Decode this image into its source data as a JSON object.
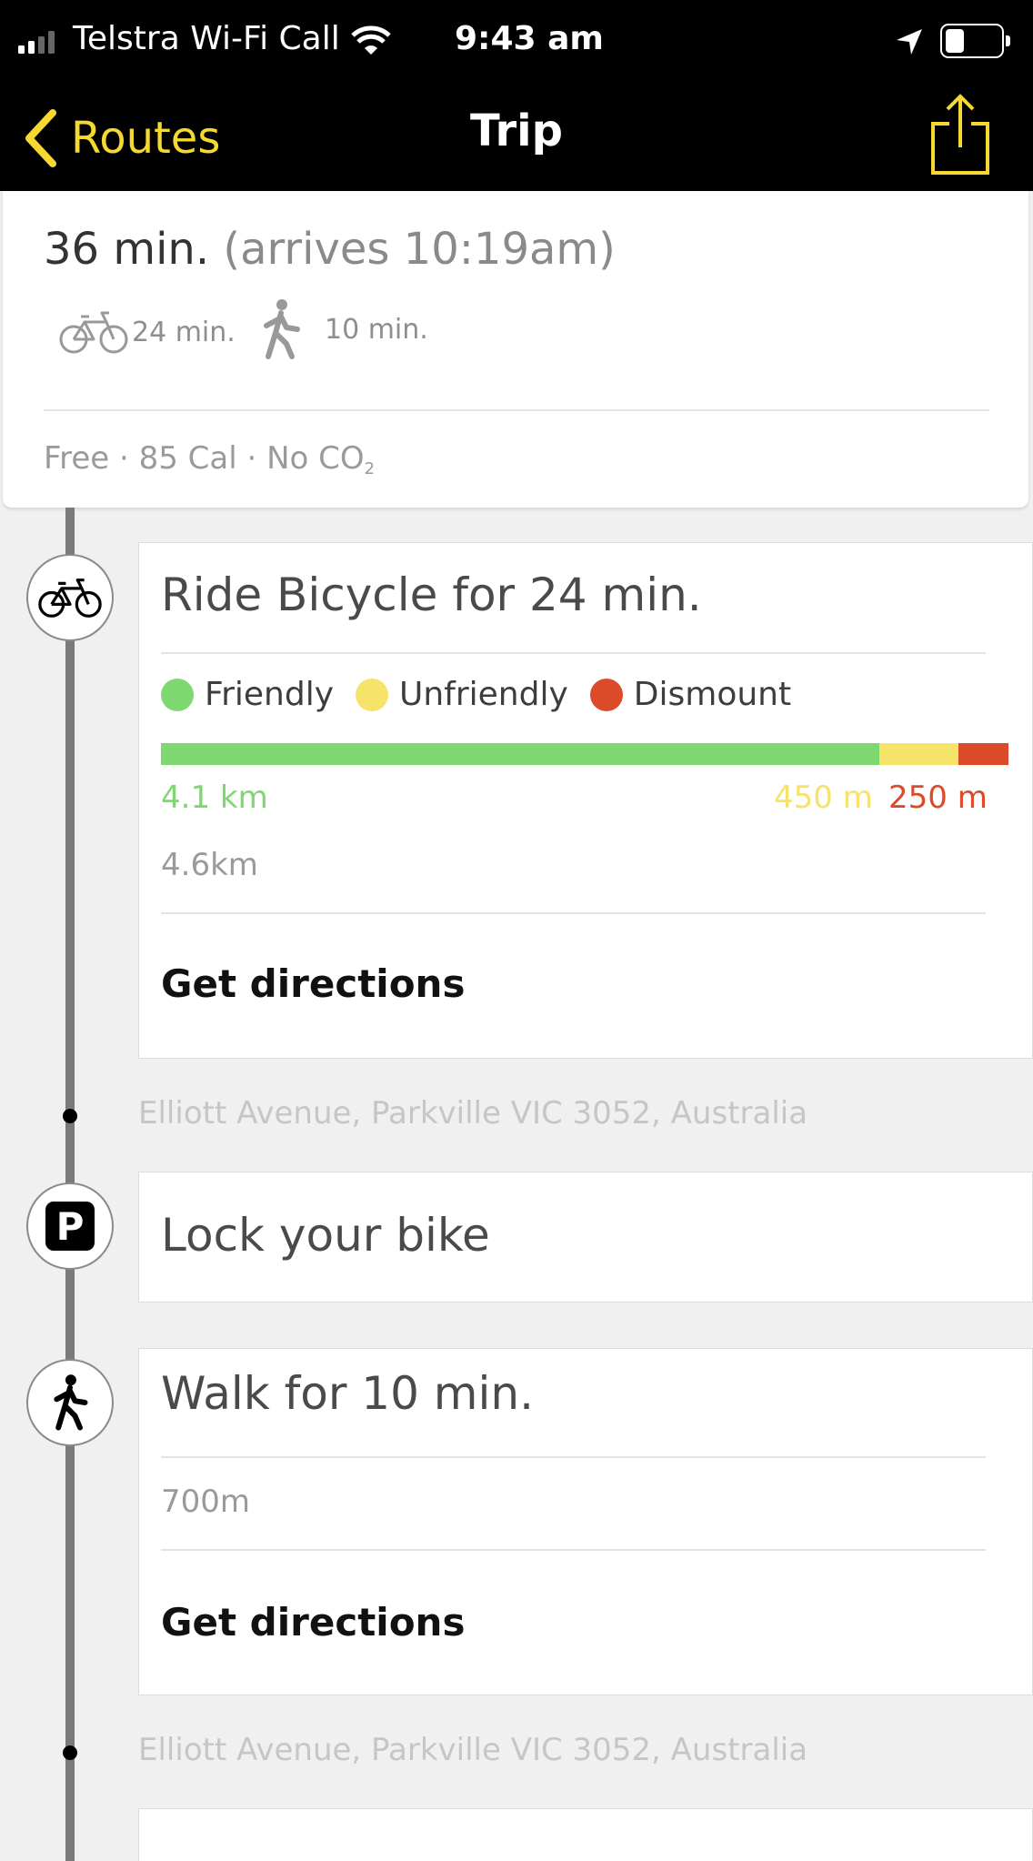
{
  "status_bar": {
    "carrier": "Telstra Wi-Fi Call",
    "time": "9:43 am",
    "signal_bars": 2,
    "battery_level": 0.35
  },
  "nav": {
    "back_label": "Routes",
    "title": "Trip",
    "back_icon": "chevron-left-icon",
    "share_icon": "share-icon"
  },
  "summary": {
    "duration": "36 min.",
    "arrives": "(arrives 10:19am)",
    "modes": [
      {
        "icon": "bicycle-icon",
        "time": "24 min."
      },
      {
        "icon": "walk-icon",
        "time": "10 min."
      }
    ],
    "meta": "Free · 85 Cal · No CO",
    "meta_sub": "2"
  },
  "steps": {
    "ride": {
      "icon": "bicycle-icon",
      "title": "Ride Bicycle for 24 min.",
      "legend": [
        {
          "label": "Friendly",
          "color": "#7dd870"
        },
        {
          "label": "Unfriendly",
          "color": "#f6e36a"
        },
        {
          "label": "Dismount",
          "color": "#db4b2a"
        }
      ],
      "segments": [
        {
          "label": "4.1 km",
          "meters": 4100,
          "color": "#7dd870"
        },
        {
          "label": "450 m",
          "meters": 450,
          "color": "#f6e36a"
        },
        {
          "label": "250 m",
          "meters": 250,
          "color": "#db4b2a"
        }
      ],
      "distance": "4.6km",
      "directions": "Get directions"
    },
    "ride_end_address": "Elliott Avenue, Parkville VIC 3052, Australia",
    "lock": {
      "icon": "parking-icon",
      "icon_letter": "P",
      "title": "Lock your bike"
    },
    "walk": {
      "icon": "walk-icon",
      "title": "Walk for 10 min.",
      "distance": "700m",
      "directions": "Get directions"
    },
    "walk_end_address": "Elliott Avenue, Parkville VIC 3052, Australia"
  },
  "colors": {
    "accent": "#f5d931",
    "nav_background": "#000000",
    "timeline": "#7a7a7a"
  }
}
